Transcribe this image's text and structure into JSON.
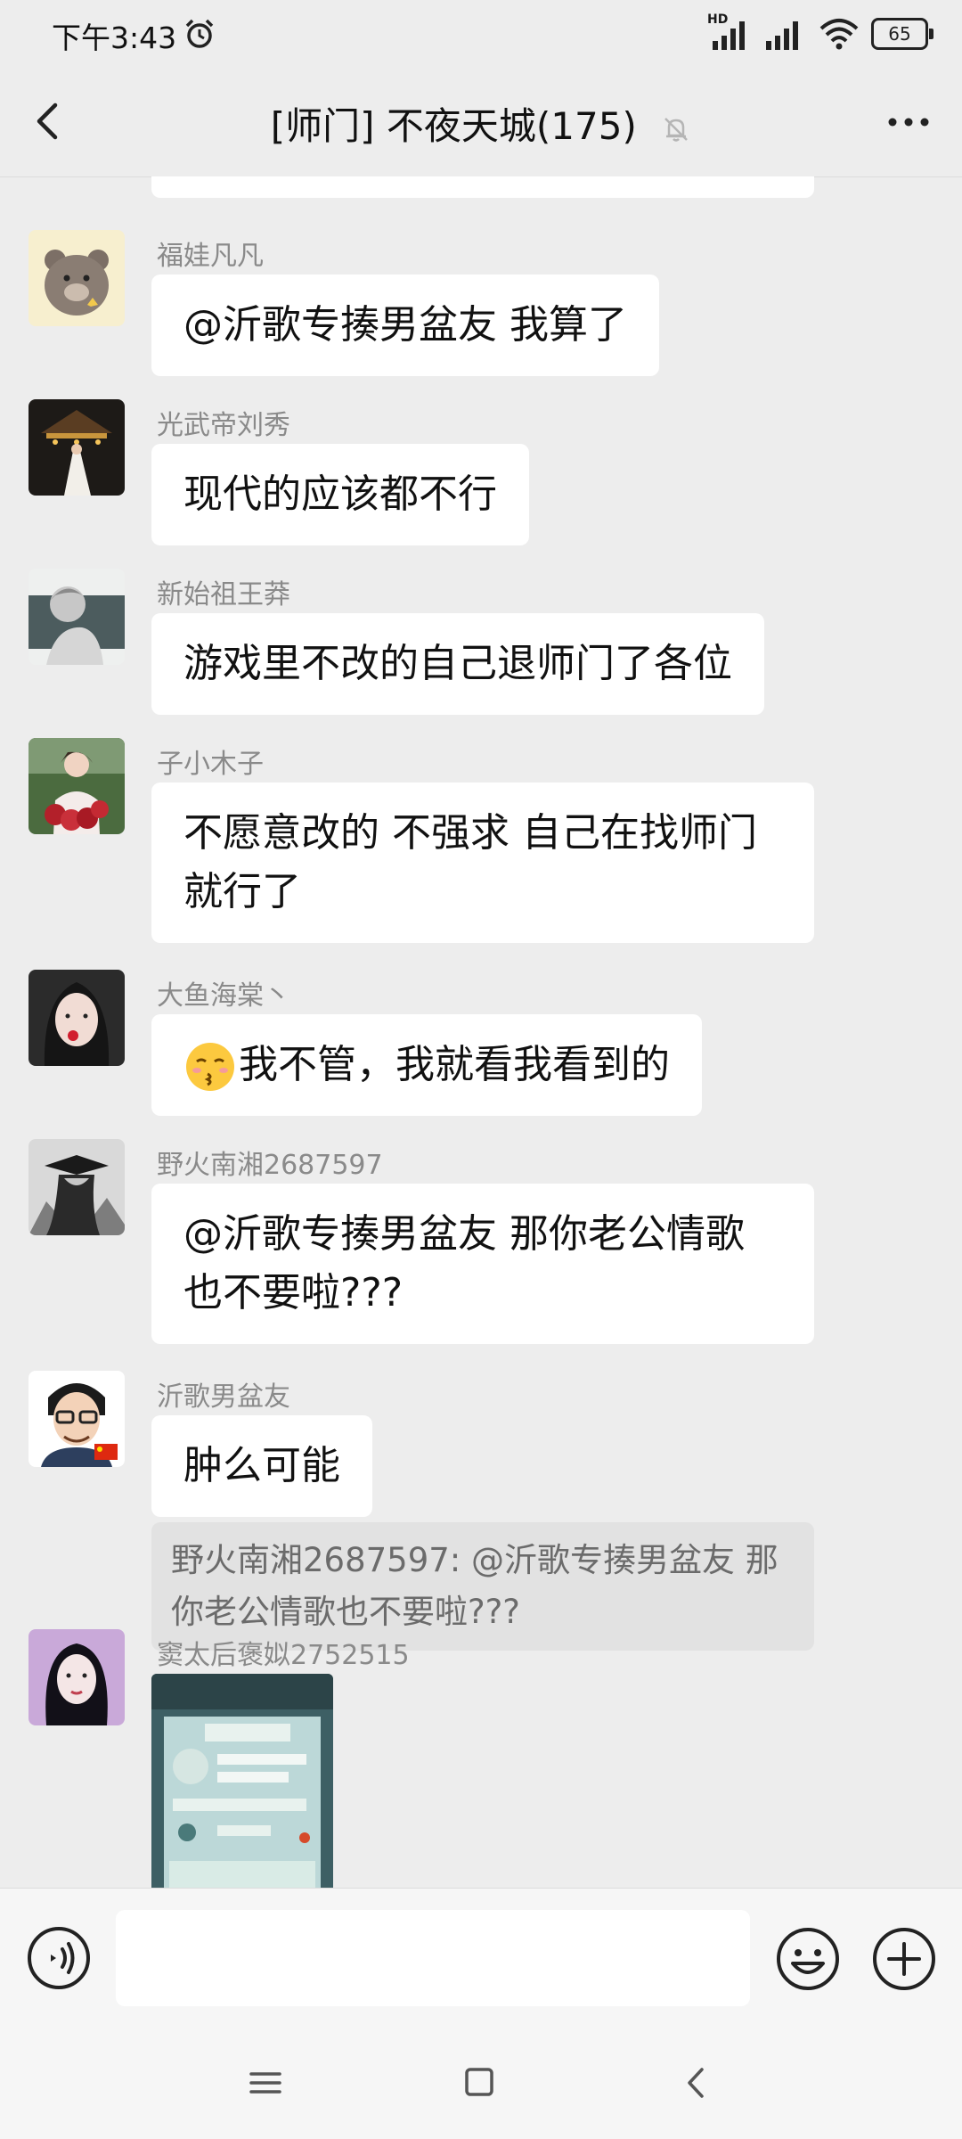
{
  "status_bar": {
    "time": "下午3:43",
    "network": "HD",
    "battery": "65"
  },
  "header": {
    "title": "[师门] 不夜天城(175)"
  },
  "messages": [
    {
      "sender": "福娃凡凡",
      "text": "@沂歌专揍男盆友  我算了"
    },
    {
      "sender": "光武帝刘秀",
      "text": "现代的应该都不行"
    },
    {
      "sender": "新始祖王莽",
      "text": "游戏里不改的自己退师门了各位"
    },
    {
      "sender": "子小木子",
      "line1": "不愿意改的  不强求 自己在找师门",
      "line2": "就行了"
    },
    {
      "sender": "大鱼海棠丶",
      "text": "我不管，我就看我看到的"
    },
    {
      "sender": "野火南湘2687597",
      "line1": "@沂歌专揍男盆友  那你老公情歌",
      "line2": "也不要啦???"
    },
    {
      "sender": "沂歌男盆友",
      "text": "肿么可能",
      "quote_line1": "野火南湘2687597: @沂歌专揍男盆友 那",
      "quote_line2": "你老公情歌也不要啦???"
    },
    {
      "sender": "窦太后褒姒2752515"
    }
  ],
  "input": {
    "value": ""
  }
}
